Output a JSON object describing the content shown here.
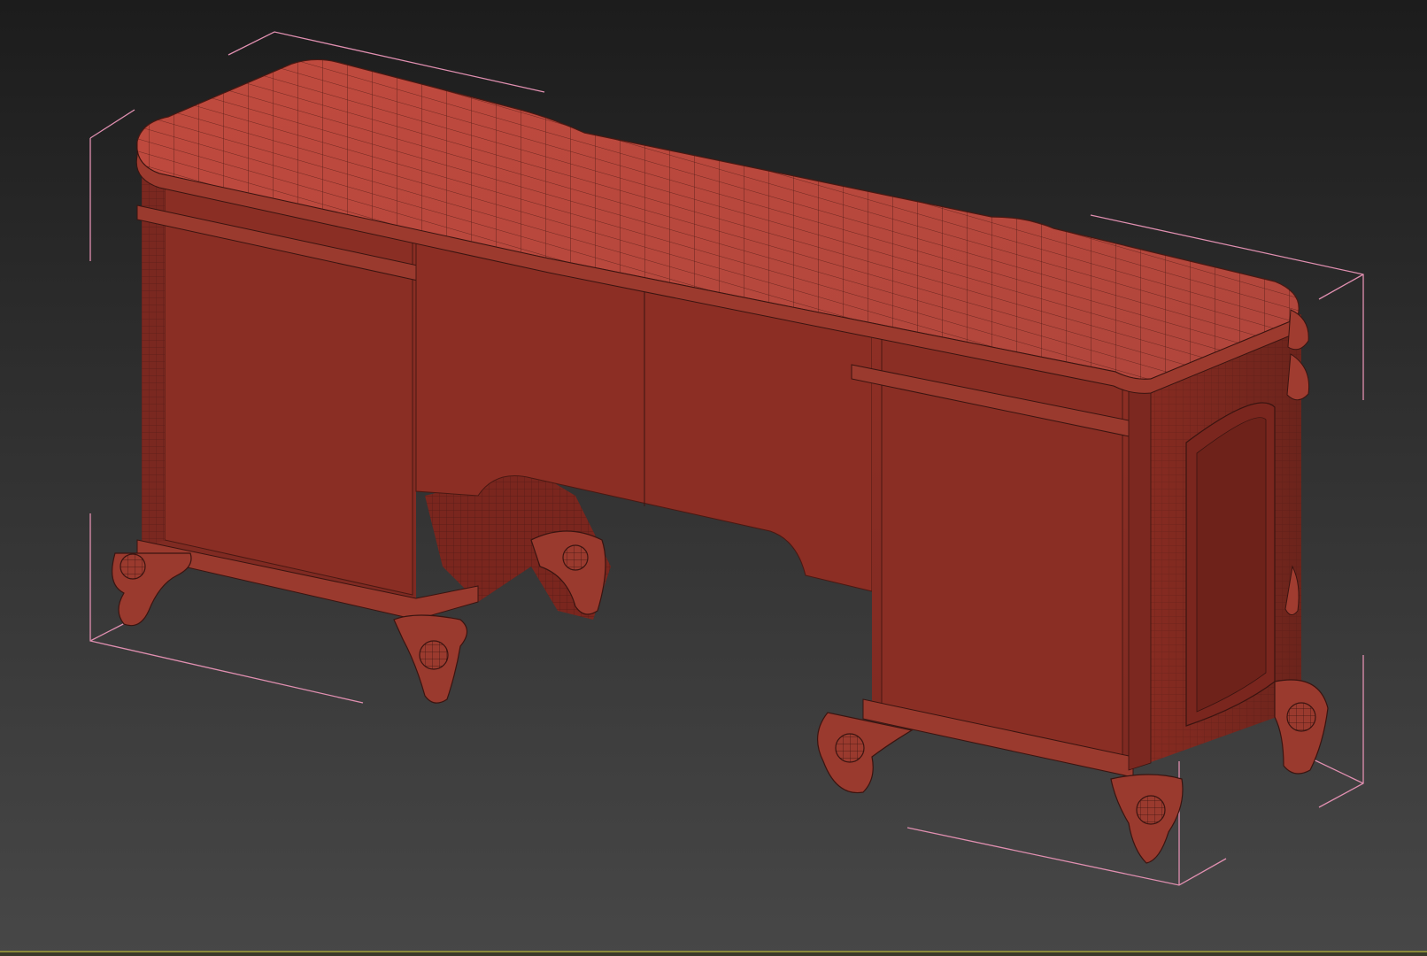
{
  "viewport": {
    "background_top": "#1c1c1c",
    "background_bottom": "#474747",
    "border_color": "#8a8a3a"
  },
  "model": {
    "name_icon": "dressing-table-model",
    "shade_color": "#b4463c",
    "dark_shade": "#8a2e24",
    "side_shade": "#7a2820",
    "wire_color": "#3a1410",
    "bbox_color": "#e08fb0",
    "display_mode": "wireframe-over-shaded",
    "selected": true
  }
}
